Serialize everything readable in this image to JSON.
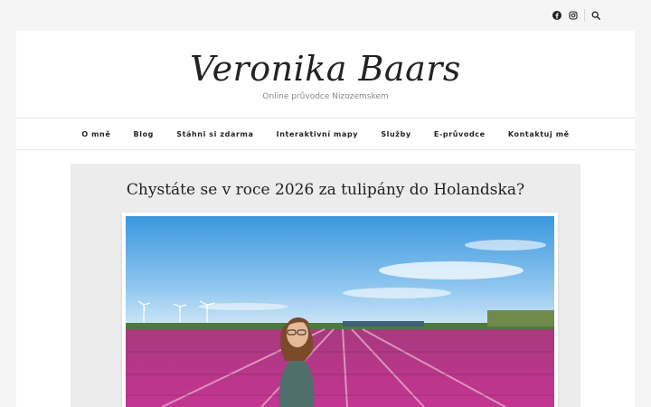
{
  "topbar": {
    "icons": [
      "facebook-icon",
      "instagram-icon",
      "search-icon"
    ]
  },
  "header": {
    "site_title": "Veronika Baars",
    "tagline": "Online průvodce Nizozemskem"
  },
  "nav": {
    "items": [
      "O mně",
      "Blog",
      "Stáhni si zdarma",
      "Interaktivní mapy",
      "Služby",
      "E-průvodce",
      "Kontaktuj mě"
    ]
  },
  "post": {
    "title": "Chystáte se v roce 2026 za tulipány do Holandska?"
  },
  "colors": {
    "background": "#f5f5f5",
    "content_bg": "#ececec",
    "tulip_pink": "#c0368f",
    "sky": "#3f9ee0"
  }
}
